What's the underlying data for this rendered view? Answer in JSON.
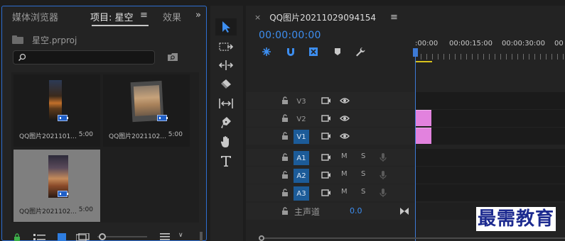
{
  "project_panel": {
    "tabs": [
      {
        "label": "媒体浏览器",
        "active": false
      },
      {
        "label": "项目: 星空",
        "active": true
      },
      {
        "label": "效果",
        "active": false
      }
    ],
    "menu_icon": "hamburger-menu-icon",
    "overflow_icon": "double-chevron-right-icon",
    "project_file": "星空.prproj",
    "search": {
      "value": "",
      "placeholder": ""
    },
    "clips": [
      {
        "name": "QQ图片2021101...",
        "duration": "5:00",
        "selected": false
      },
      {
        "name": "QQ图片2021102...",
        "duration": "5:00",
        "selected": false
      },
      {
        "name": "QQ图片2021102...",
        "duration": "5:00",
        "selected": true
      }
    ]
  },
  "tools": [
    {
      "name": "selection-tool-icon",
      "active": true
    },
    {
      "name": "track-select-tool-icon",
      "active": false
    },
    {
      "name": "ripple-edit-tool-icon",
      "active": false
    },
    {
      "name": "razor-tool-icon",
      "active": false
    },
    {
      "name": "slip-tool-icon",
      "active": false
    },
    {
      "name": "pen-tool-icon",
      "active": false
    },
    {
      "name": "hand-tool-icon",
      "active": false
    },
    {
      "name": "type-tool-icon",
      "active": false
    }
  ],
  "timeline": {
    "sequence_name": "QQ图片20211029094154",
    "timecode": "00:00:00:00",
    "ruler_labels": [
      ":00:00",
      "00:00:15:00",
      "00:00:30:00",
      "00"
    ],
    "video_tracks": [
      {
        "label": "V3",
        "targeted": false,
        "has_clip": false
      },
      {
        "label": "V2",
        "targeted": false,
        "has_clip": true
      },
      {
        "label": "V1",
        "targeted": true,
        "has_clip": true
      }
    ],
    "audio_tracks": [
      {
        "label": "A1",
        "targeted": true,
        "mute": "M",
        "solo": "S"
      },
      {
        "label": "A2",
        "targeted": true,
        "mute": "M",
        "solo": "S"
      },
      {
        "label": "A3",
        "targeted": true,
        "mute": "M",
        "solo": "S"
      }
    ],
    "master": {
      "label": "主声道",
      "value": "0.0"
    }
  },
  "watermark": "最需教育",
  "colors": {
    "accent_blue": "#3d8ef0",
    "panel_border": "#2e6ed1",
    "clip_pink": "#e282de",
    "track_target": "#1c5b98",
    "work_area": "#d8c21d"
  }
}
